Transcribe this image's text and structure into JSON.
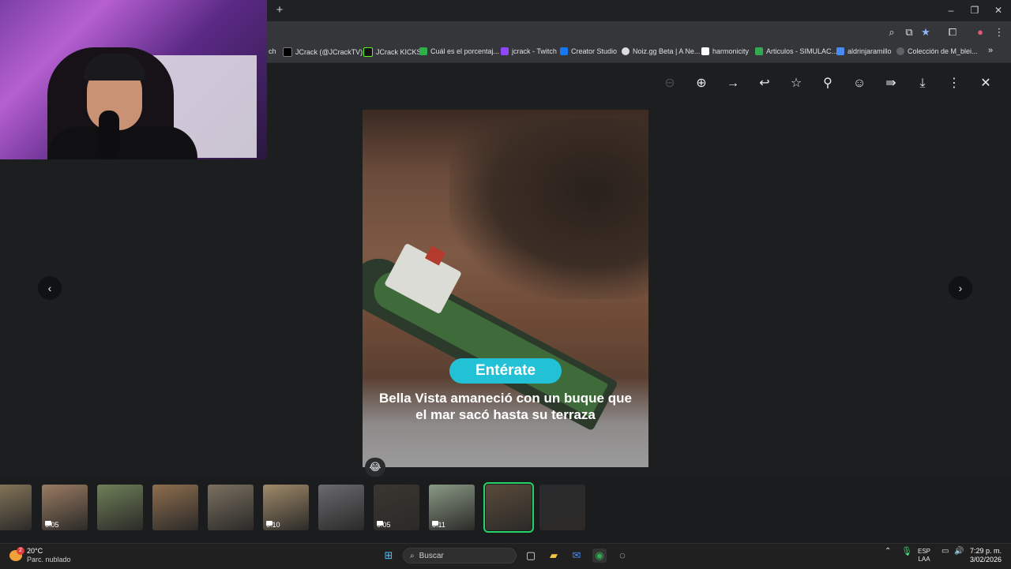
{
  "browser": {
    "new_tab": "+",
    "window_controls": [
      "–",
      "❐",
      "✕"
    ],
    "toolbar_icons": [
      "zoom-icon",
      "cast-icon",
      "star-icon",
      "extensions-icon",
      "profile-icon",
      "menu-icon"
    ],
    "bookmarks": [
      {
        "label": "ch",
        "color": "#35363a"
      },
      {
        "label": "JCrack (@JCrackTV)...",
        "color": "#000000"
      },
      {
        "label": "JCrack KICKS",
        "color": "#53fc18"
      },
      {
        "label": "Cuál es el porcentaj...",
        "color": "#2db24a"
      },
      {
        "label": "jcrack - Twitch",
        "color": "#9146ff"
      },
      {
        "label": "Creator Studio",
        "color": "#1877f2"
      },
      {
        "label": "Noiz.gg Beta | A Ne...",
        "color": "#dddddd"
      },
      {
        "label": "harmonicity",
        "color": "#ffffff"
      },
      {
        "label": "Articulos - SIMULAC...",
        "color": "#34a853"
      },
      {
        "label": "aldrinjaramillo",
        "color": "#4a8af4"
      },
      {
        "label": "Colección de M_blei...",
        "color": "#5f6368"
      }
    ],
    "bookmarks_more": "»"
  },
  "viewer": {
    "actions": [
      "zoom-out",
      "zoom-in",
      "forward",
      "reply",
      "star",
      "pin",
      "react",
      "share",
      "download",
      "more",
      "close"
    ],
    "prev": "‹",
    "next": "›",
    "image": {
      "badge": "Entérate",
      "headline": "Bella Vista amaneció con un buque que el mar sacó hasta su terraza"
    },
    "reaction_emoji": "😂",
    "thumbnails": [
      {
        "duration": "",
        "video": false,
        "active": false,
        "bg": "#8a7a5c"
      },
      {
        "duration": "0:05",
        "video": true,
        "active": false,
        "bg": "#9a7c62"
      },
      {
        "duration": "",
        "video": false,
        "active": false,
        "bg": "#6e8058"
      },
      {
        "duration": "",
        "video": false,
        "active": false,
        "bg": "#8e6e4e"
      },
      {
        "duration": "",
        "video": false,
        "active": false,
        "bg": "#7a7060"
      },
      {
        "duration": "0:10",
        "video": true,
        "active": false,
        "bg": "#a08a6a"
      },
      {
        "duration": "",
        "video": false,
        "active": false,
        "bg": "#6a6a70"
      },
      {
        "duration": "0:05",
        "video": true,
        "active": false,
        "bg": "#3a3630"
      },
      {
        "duration": "0:11",
        "video": true,
        "active": false,
        "bg": "#8a9a86"
      },
      {
        "duration": "",
        "video": false,
        "active": true,
        "bg": "#5a4a3a"
      },
      {
        "duration": "",
        "video": false,
        "active": false,
        "bg": "#2a2a2c"
      }
    ]
  },
  "taskbar": {
    "weather": {
      "temp": "20°C",
      "desc": "Parc. nublado",
      "badge": "2"
    },
    "search_placeholder": "Buscar",
    "lang": {
      "line1": "ESP",
      "line2": "LAA"
    },
    "clock": {
      "time": "7:29 p. m.",
      "date": "3/02/2026"
    }
  }
}
